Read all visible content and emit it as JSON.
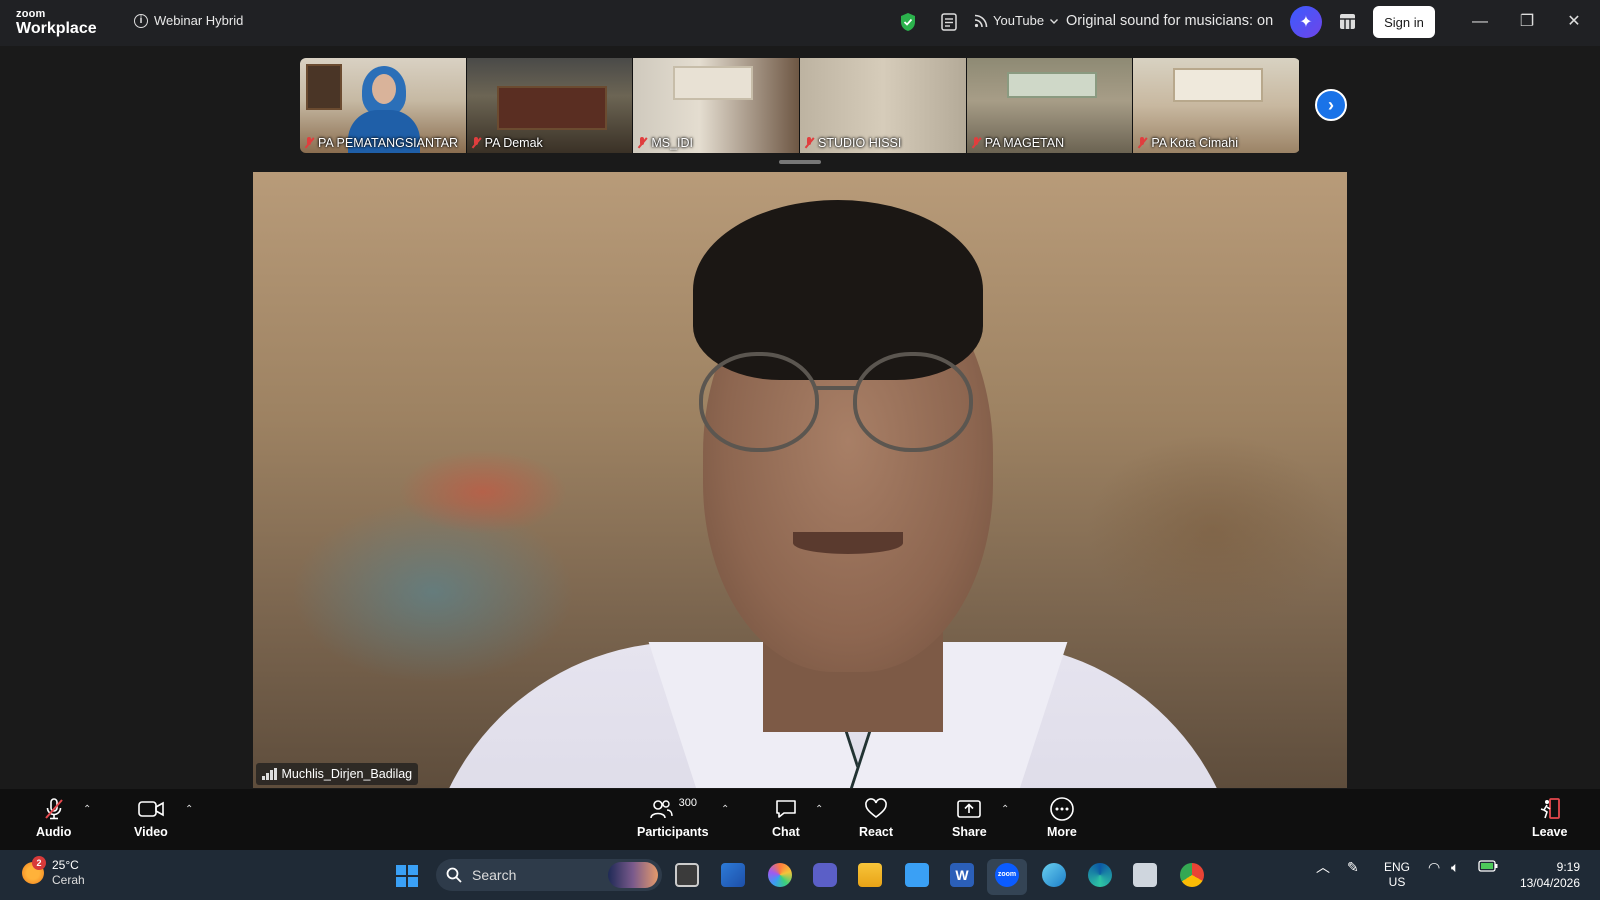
{
  "titlebar": {
    "logo_top": "zoom",
    "logo_bottom": "Workplace",
    "meeting_title": "Webinar Hybrid",
    "stream_label": "YouTube",
    "sound_status": "Original sound for musicians: on",
    "signin_label": "Sign in"
  },
  "gallery": {
    "tiles": [
      {
        "name": "PA PEMATANGSIANTAR"
      },
      {
        "name": "PA Demak"
      },
      {
        "name": "MS_IDI"
      },
      {
        "name": "STUDIO HISSI"
      },
      {
        "name": "PA MAGETAN"
      },
      {
        "name": "PA Kota Cimahi"
      }
    ]
  },
  "main": {
    "speaker_name": "Muchlis_Dirjen_Badilag"
  },
  "toolbar": {
    "audio_label": "Audio",
    "video_label": "Video",
    "participants_label": "Participants",
    "participants_count": "300",
    "chat_label": "Chat",
    "react_label": "React",
    "share_label": "Share",
    "more_label": "More",
    "leave_label": "Leave"
  },
  "taskbar": {
    "weather_temp": "25°C",
    "weather_cond": "Cerah",
    "weather_badge": "2",
    "search_label": "Search",
    "lang_top": "ENG",
    "lang_bottom": "US",
    "time": "9:19",
    "date": "13/04/2026"
  },
  "colors": {
    "accent": "#1a73e8",
    "muted_red": "#e03e3e",
    "shield_green": "#2bb24c",
    "leave_red": "#e5484d"
  }
}
